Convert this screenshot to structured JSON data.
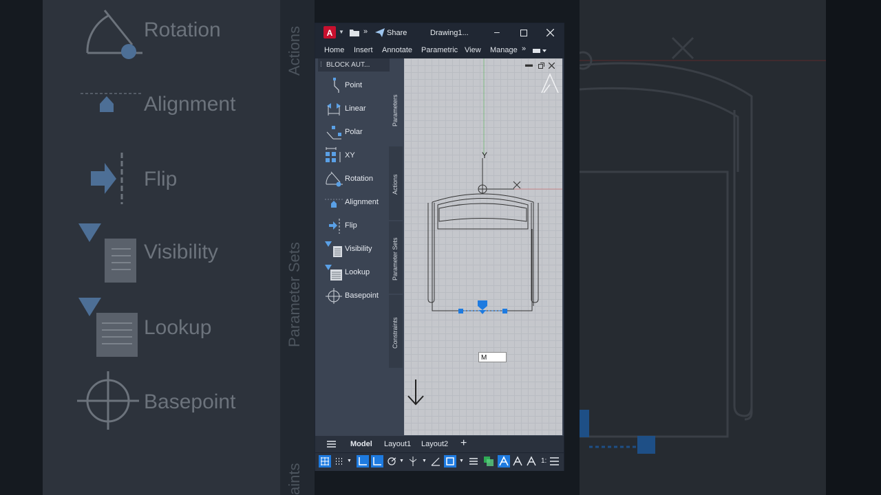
{
  "background_left": {
    "items": [
      {
        "label": "Rotation",
        "icon": "rotation-icon"
      },
      {
        "label": "Alignment",
        "icon": "alignment-icon"
      },
      {
        "label": "Flip",
        "icon": "flip-icon"
      },
      {
        "label": "Visibility",
        "icon": "visibility-icon"
      },
      {
        "label": "Lookup",
        "icon": "lookup-icon"
      },
      {
        "label": "Basepoint",
        "icon": "basepoint-icon"
      }
    ],
    "vertical_tabs": [
      "Actions",
      "Parameter Sets",
      "aints"
    ]
  },
  "window": {
    "share_label": "Share",
    "title": "Drawing1...",
    "menu": [
      "Home",
      "Insert",
      "Annotate",
      "Parametric",
      "View",
      "Manage"
    ],
    "palette": {
      "title": "BLOCK AUT...",
      "items": [
        {
          "label": "Point",
          "icon": "point-icon"
        },
        {
          "label": "Linear",
          "icon": "linear-icon"
        },
        {
          "label": "Polar",
          "icon": "polar-icon"
        },
        {
          "label": "XY",
          "icon": "xy-icon"
        },
        {
          "label": "Rotation",
          "icon": "rotation-icon"
        },
        {
          "label": "Alignment",
          "icon": "alignment-icon"
        },
        {
          "label": "Flip",
          "icon": "flip-icon"
        },
        {
          "label": "Visibility",
          "icon": "visibility-icon"
        },
        {
          "label": "Lookup",
          "icon": "lookup-icon"
        },
        {
          "label": "Basepoint",
          "icon": "basepoint-icon"
        }
      ],
      "tabs": [
        "Parameters",
        "Actions",
        "Parameter Sets",
        "Constraints"
      ]
    },
    "canvas": {
      "axis_y_label": "Y",
      "command_input": "M"
    },
    "layout_tabs": [
      "Model",
      "Layout1",
      "Layout2"
    ],
    "status_scale": "1:"
  },
  "colors": {
    "accent": "#5aa0e6",
    "grip_blue": "#1e7be0",
    "app_red": "#c8102e"
  }
}
